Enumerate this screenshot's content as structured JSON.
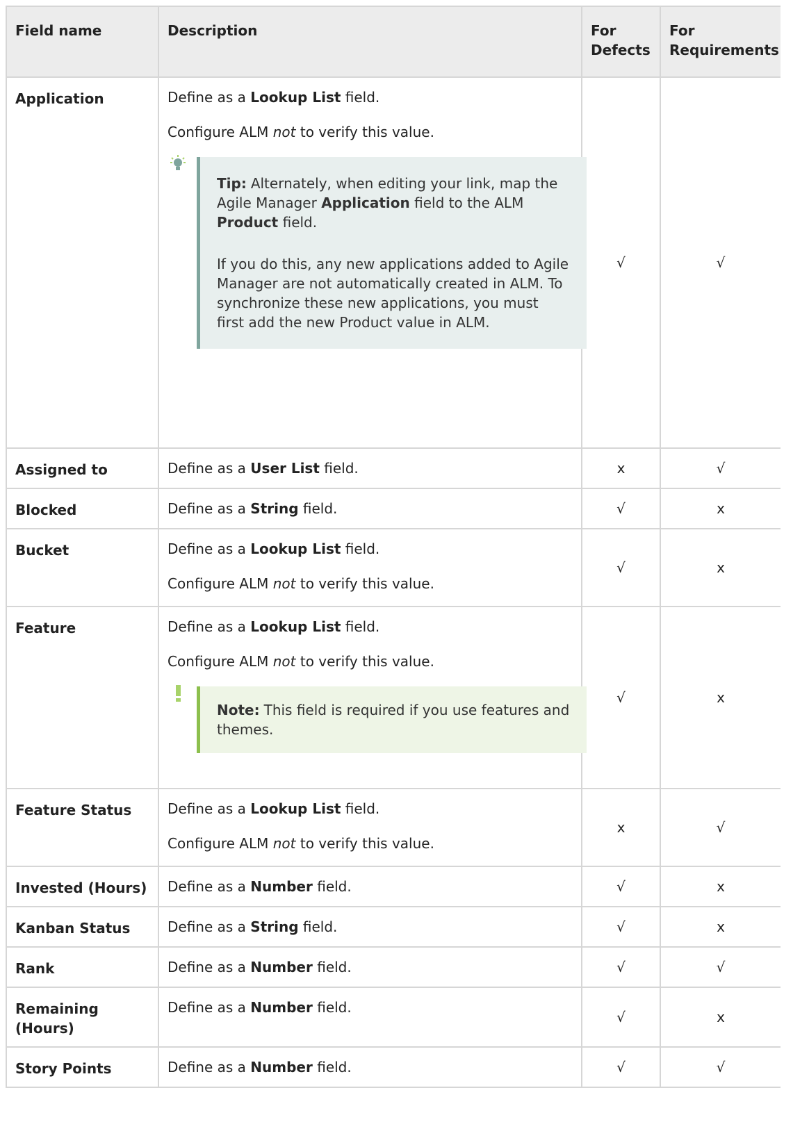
{
  "table": {
    "headers": [
      "Field name",
      "Description",
      "For Defects",
      "For Requirements"
    ],
    "rows": [
      {
        "name": "Application",
        "desc": [
          {
            "pre": "Define as a ",
            "bold": "Lookup List",
            "post": " field."
          },
          {
            "pre": "Configure ALM ",
            "italic": "not",
            "post": " to verify this value."
          }
        ],
        "tip": {
          "lead": "Tip:",
          "p1_a": "Alternately, when editing your link, map the Agile Manager ",
          "p1_b": "Application",
          "p1_c": " field to the ALM ",
          "p1_d": "Product",
          "p1_e": " field.",
          "p2": "If you do this, any new applications added to Agile Manager are not automatically created in ALM. To synchronize these new applications, you must first add the new Product value in ALM."
        },
        "defects": "√",
        "requirements": "√"
      },
      {
        "name": "Assigned to",
        "desc": [
          {
            "pre": "Define as a ",
            "bold": "User List",
            "post": " field."
          }
        ],
        "defects": "x",
        "requirements": "√"
      },
      {
        "name": "Blocked",
        "desc": [
          {
            "pre": "Define as a ",
            "bold": "String",
            "post": " field."
          }
        ],
        "defects": "√",
        "requirements": "x"
      },
      {
        "name": "Bucket",
        "desc": [
          {
            "pre": "Define as a ",
            "bold": "Lookup List",
            "post": " field."
          },
          {
            "pre": "Configure ALM ",
            "italic": "not",
            "post": " to verify this value."
          }
        ],
        "defects": "√",
        "requirements": "x"
      },
      {
        "name": "Feature",
        "desc": [
          {
            "pre": "Define as a ",
            "bold": "Lookup List",
            "post": " field."
          },
          {
            "pre": "Configure ALM ",
            "italic": "not",
            "post": " to verify this value."
          }
        ],
        "note": {
          "lead": "Note:",
          "text": "This field is required if you use features and themes."
        },
        "defects": "√",
        "requirements": "x"
      },
      {
        "name": "Feature Status",
        "desc": [
          {
            "pre": "Define as a ",
            "bold": "Lookup List",
            "post": " field."
          },
          {
            "pre": "Configure ALM ",
            "italic": "not",
            "post": " to verify this value."
          }
        ],
        "defects": "x",
        "requirements": "√"
      },
      {
        "name": "Invested (Hours)",
        "desc": [
          {
            "pre": "Define as a ",
            "bold": "Number",
            "post": " field."
          }
        ],
        "defects": "√",
        "requirements": "x"
      },
      {
        "name": "Kanban Status",
        "desc": [
          {
            "pre": "Define as a ",
            "bold": "String",
            "post": " field."
          }
        ],
        "defects": "√",
        "requirements": "x"
      },
      {
        "name": "Rank",
        "desc": [
          {
            "pre": "Define as a ",
            "bold": "Number",
            "post": " field."
          }
        ],
        "defects": "√",
        "requirements": "√"
      },
      {
        "name": "Remaining (Hours)",
        "desc": [
          {
            "pre": "Define as a ",
            "bold": "Number",
            "post": " field."
          }
        ],
        "defects": "√",
        "requirements": "x"
      },
      {
        "name": "Story Points",
        "desc": [
          {
            "pre": "Define as a ",
            "bold": "Number",
            "post": " field."
          }
        ],
        "defects": "√",
        "requirements": "√"
      }
    ]
  },
  "icons": {
    "tip": "lightbulb-icon",
    "note": "exclamation-icon"
  },
  "colors": {
    "header_bg": "#ececec",
    "tip_bg": "#e8efee",
    "tip_border": "#7fa59d",
    "note_bg": "#eef5e6",
    "note_border": "#8cbf4d"
  }
}
